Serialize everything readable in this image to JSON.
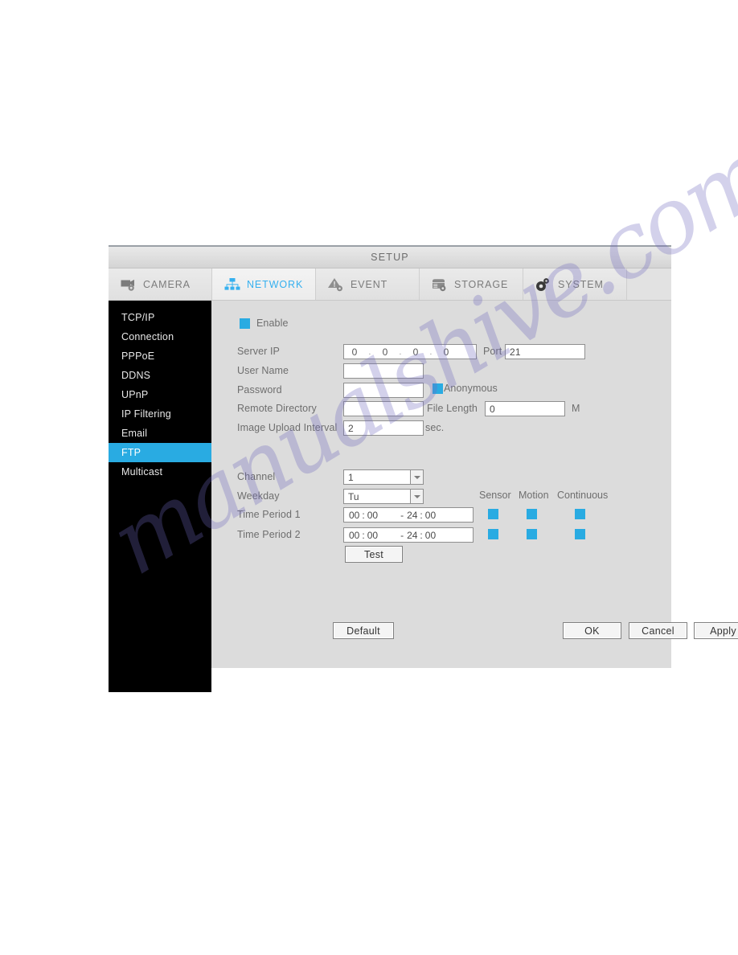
{
  "window": {
    "title": "SETUP"
  },
  "tabs": [
    {
      "label": "CAMERA",
      "icon": "camera-gear-icon",
      "active": false
    },
    {
      "label": "NETWORK",
      "icon": "network-tree-icon",
      "active": true
    },
    {
      "label": "EVENT",
      "icon": "warning-gear-icon",
      "active": false
    },
    {
      "label": "STORAGE",
      "icon": "storage-gear-icon",
      "active": false
    },
    {
      "label": "SYSTEM",
      "icon": "gears-icon",
      "active": false
    }
  ],
  "sidebar": {
    "items": [
      {
        "label": "TCP/IP",
        "selected": false
      },
      {
        "label": "Connection",
        "selected": false
      },
      {
        "label": "PPPoE",
        "selected": false
      },
      {
        "label": "DDNS",
        "selected": false
      },
      {
        "label": "UPnP",
        "selected": false
      },
      {
        "label": "IP Filtering",
        "selected": false
      },
      {
        "label": "Email",
        "selected": false
      },
      {
        "label": "FTP",
        "selected": true
      },
      {
        "label": "Multicast",
        "selected": false
      }
    ]
  },
  "form": {
    "enable": {
      "label": "Enable",
      "checked": true
    },
    "server_ip": {
      "label": "Server IP",
      "octets": [
        "0",
        "0",
        "0",
        "0"
      ],
      "dot": "."
    },
    "port": {
      "label": "Port",
      "value": "21"
    },
    "user_name": {
      "label": "User Name",
      "value": ""
    },
    "password": {
      "label": "Password",
      "value": ""
    },
    "anonymous": {
      "label": "Anonymous",
      "checked": true
    },
    "remote_directory": {
      "label": "Remote Directory",
      "value": ""
    },
    "file_length": {
      "label": "File Length",
      "value": "0",
      "unit": "M"
    },
    "image_upload_interval": {
      "label": "Image Upload Interval",
      "value": "2",
      "unit": "sec."
    },
    "channel": {
      "label": "Channel",
      "value": "1"
    },
    "weekday": {
      "label": "Weekday",
      "value": "Tu"
    },
    "columns": [
      "Sensor",
      "Motion",
      "Continuous"
    ],
    "time_periods": [
      {
        "label": "Time Period 1",
        "start_h": "00",
        "start_m": "00",
        "sep": "-",
        "end_h": "24",
        "end_m": "00",
        "colon": ":",
        "sensor": true,
        "motion": true,
        "continuous": true
      },
      {
        "label": "Time Period 2",
        "start_h": "00",
        "start_m": "00",
        "sep": "-",
        "end_h": "24",
        "end_m": "00",
        "colon": ":",
        "sensor": true,
        "motion": true,
        "continuous": true
      }
    ],
    "test_button": "Test"
  },
  "footer": {
    "default_label": "Default",
    "ok_label": "OK",
    "cancel_label": "Cancel",
    "apply_label": "Apply"
  },
  "watermark": {
    "text": "manualshive.com"
  },
  "colors": {
    "accent_blue": "#29ABE2",
    "sidebar_bg": "#000000",
    "dialog_bg": "#dcdcdc"
  }
}
